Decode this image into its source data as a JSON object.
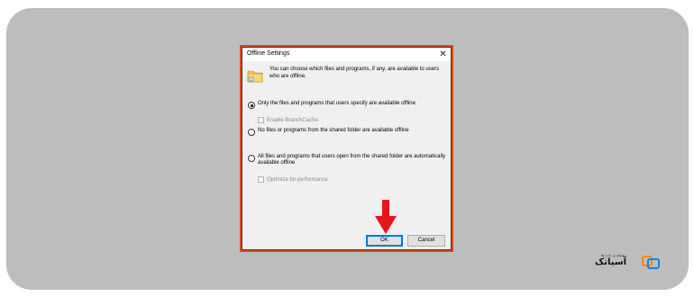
{
  "dialog": {
    "title": "Offline Settings",
    "close_glyph": "✕",
    "info_text": "You can choose which files and programs, if any, are available to users who are offline.",
    "option1_label": "Only the files and programs that users specify are available offline",
    "option1_checked": true,
    "branchcache_label": "Enable BranchCache",
    "option2_label": "No files or programs from the shared folder are available offline",
    "option3_label": "All files and programs that users open from the shared folder are automatically available offline",
    "optimize_label": "Optimize for performance",
    "ok_label": "OK",
    "cancel_label": "Cancel"
  },
  "icons": {
    "folder": "folder-sync-icon",
    "arrow": "red-down-arrow-icon",
    "logo": "asiatech-logo"
  },
  "colors": {
    "highlight_frame": "#e0461e",
    "arrow": "#e8141b",
    "ok_focus": "#0078d7",
    "backdrop": "#bdbdbd",
    "logo_blue": "#1f7fd6",
    "logo_orange": "#f08a1c"
  },
  "logo": {
    "small_text": "شبکه ی داده ها",
    "big_text": "آسیاتک"
  }
}
